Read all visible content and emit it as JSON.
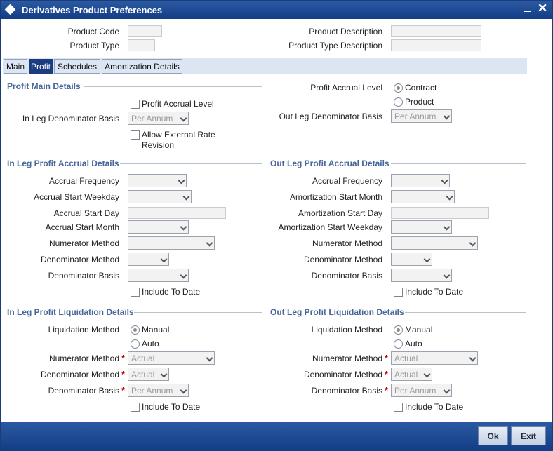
{
  "window": {
    "title": "Derivatives Product Preferences"
  },
  "header": {
    "product_code_label": "Product Code",
    "product_type_label": "Product Type",
    "product_description_label": "Product Description",
    "product_type_description_label": "Product Type Description"
  },
  "tabs": [
    {
      "label": "Main"
    },
    {
      "label": "Profit",
      "active": true
    },
    {
      "label": "Schedules"
    },
    {
      "label": "Amortization Details"
    }
  ],
  "profit_main": {
    "section_title": "Profit Main Details",
    "profit_accrual_level_chk": "Profit Accrual Level",
    "in_leg_denominator_basis_label": "In Leg Denominator Basis",
    "in_leg_denominator_basis_value": "Per Annum",
    "allow_external_rate_line1": "Allow External Rate",
    "allow_external_rate_line2": "Revision",
    "profit_accrual_level_label": "Profit Accrual Level",
    "contract_option": "Contract",
    "product_option": "Product",
    "selected_level": "Contract",
    "out_leg_denominator_basis_label": "Out Leg Denominator Basis",
    "out_leg_denominator_basis_value": "Per Annum"
  },
  "in_leg_accrual": {
    "section_title": "In Leg Profit Accrual Details",
    "accrual_frequency": "Accrual Frequency",
    "accrual_start_weekday": "Accrual Start Weekday",
    "accrual_start_day": "Accrual Start Day",
    "accrual_start_month": "Accrual Start Month",
    "numerator_method": "Numerator Method",
    "denominator_method": "Denominator Method",
    "denominator_basis": "Denominator Basis",
    "include_to_date": "Include To Date"
  },
  "out_leg_accrual": {
    "section_title": "Out Leg Profit Accrual Details",
    "accrual_frequency": "Accrual Frequency",
    "amortization_start_month": "Amortization Start Month",
    "amortization_start_day": "Amortization Start Day",
    "amortization_start_weekday": "Amortization Start Weekday",
    "numerator_method": "Numerator Method",
    "denominator_method": "Denominator Method",
    "denominator_basis": "Denominator Basis",
    "include_to_date": "Include To Date"
  },
  "in_leg_liquidation": {
    "section_title": "In Leg Profit Liquidation Details",
    "liquidation_method": "Liquidation Method",
    "manual_option": "Manual",
    "auto_option": "Auto",
    "selected_method": "Manual",
    "numerator_method": "Numerator Method",
    "numerator_value": "Actual",
    "denominator_method": "Denominator Method",
    "denominator_value": "Actual",
    "denominator_basis": "Denominator Basis",
    "denominator_basis_value": "Per Annum",
    "include_to_date": "Include To Date",
    "required_mark": "*"
  },
  "out_leg_liquidation": {
    "section_title": "Out Leg Profit Liquidation Details",
    "liquidation_method": "Liquidation Method",
    "manual_option": "Manual",
    "auto_option": "Auto",
    "selected_method": "Manual",
    "numerator_method": "Numerator Method",
    "numerator_value": "Actual",
    "denominator_method": "Denominator Method",
    "denominator_value": "Actual",
    "denominator_basis": "Denominator Basis",
    "denominator_basis_value": "Per Annum",
    "include_to_date": "Include To Date",
    "required_mark": "*"
  },
  "footer": {
    "ok_label": "Ok",
    "exit_label": "Exit"
  }
}
